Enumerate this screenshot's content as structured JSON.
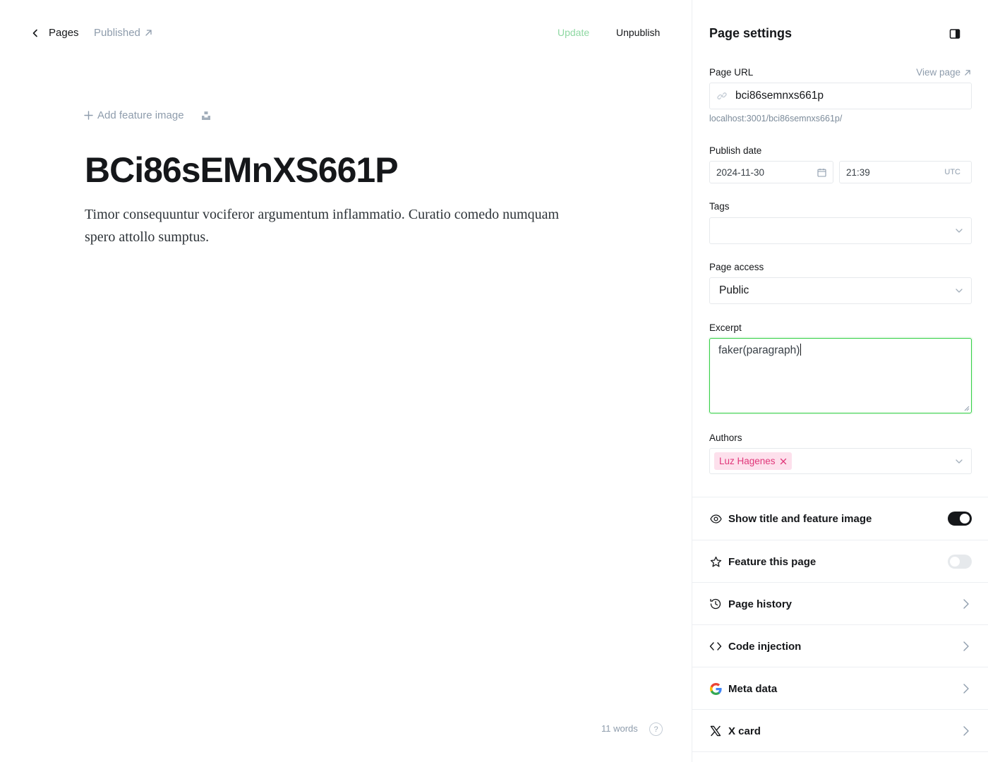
{
  "editor": {
    "breadcrumb": {
      "back": "Pages",
      "status": "Published"
    },
    "actions": {
      "update": "Update",
      "unpublish": "Unpublish"
    },
    "add_feature_image": "Add feature image",
    "title": "BCi86sEMnXS661P",
    "body": "Timor consequuntur vociferor argumentum inflammatio. Curatio comedo numquam spero attollo sumptus.",
    "word_count": "11 words",
    "help": "?"
  },
  "settings": {
    "title": "Page settings",
    "page_url": {
      "label": "Page URL",
      "view_page": "View page",
      "value": "bci86semnxs661p",
      "hint": "localhost:3001/bci86semnxs661p/"
    },
    "publish_date": {
      "label": "Publish date",
      "date": "2024-11-30",
      "time": "21:39",
      "timezone": "UTC"
    },
    "tags": {
      "label": "Tags",
      "value": ""
    },
    "page_access": {
      "label": "Page access",
      "value": "Public"
    },
    "excerpt": {
      "label": "Excerpt",
      "value": "faker(paragraph)"
    },
    "authors": {
      "label": "Authors",
      "items": [
        "Luz Hagenes"
      ]
    },
    "options": [
      {
        "label": "Show title and feature image",
        "icon": "eye-icon",
        "toggle": true
      },
      {
        "label": "Feature this page",
        "icon": "star-icon",
        "toggle": false
      },
      {
        "label": "Page history",
        "icon": "history-icon"
      },
      {
        "label": "Code injection",
        "icon": "code-icon"
      },
      {
        "label": "Meta data",
        "icon": "google-icon"
      },
      {
        "label": "X card",
        "icon": "x-icon"
      }
    ]
  },
  "colors": {
    "accent_green": "#30cf43",
    "update_green": "#8fd8a3",
    "author_chip_bg": "#fde0ec",
    "author_chip_text": "#e0377a"
  }
}
